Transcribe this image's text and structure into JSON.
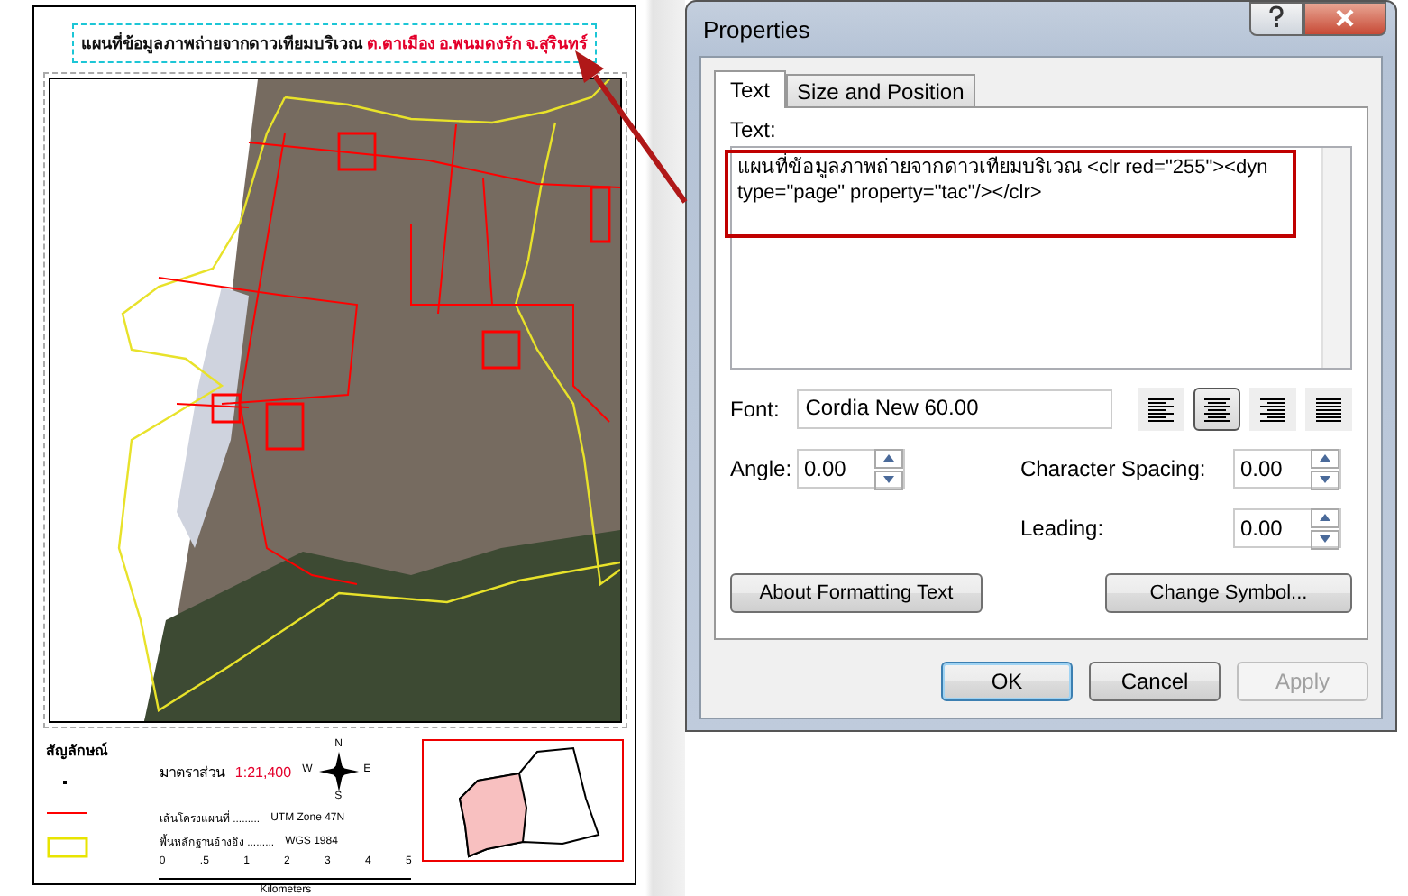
{
  "map_sheet": {
    "title": {
      "text": "แผนที่ข้อมูลภาพถ่ายจากดาวเทียมบริเวณ",
      "highlight": "ต.ตาเมือง อ.พนมดงรัก จ.สุรินทร์"
    },
    "legend": {
      "heading": "สัญลักษณ์"
    },
    "scale": {
      "label": "มาตราส่วน",
      "ratio": "1:21,400",
      "ticks": [
        "0",
        ".5",
        "1",
        "2",
        "3",
        "4",
        "5"
      ],
      "unit": "Kilometers"
    },
    "projection": [
      {
        "label": "เส้นโครงแผนที่ .........",
        "value": "UTM Zone 47N"
      },
      {
        "label": "พื้นหลักฐานอ้างอิง .........",
        "value": "WGS 1984"
      }
    ],
    "north_arrow": {
      "n": "N",
      "w": "W",
      "e": "E",
      "s": "S"
    }
  },
  "dialog": {
    "title": "Properties",
    "tabs": [
      {
        "label": "Text",
        "selected": true
      },
      {
        "label": "Size and Position",
        "selected": false
      }
    ],
    "text_label": "Text:",
    "text_value": "แผนที่ข้อมูลภาพถ่ายจากดาวเทียมบริเวณ <clr red=\"255\"><dyn type=\"page\" property=\"tac\"/></clr>",
    "font": {
      "label": "Font:",
      "value": "Cordia New 60.00"
    },
    "alignments": [
      {
        "kind": "left",
        "selected": false
      },
      {
        "kind": "center",
        "selected": true
      },
      {
        "kind": "right",
        "selected": false
      },
      {
        "kind": "justify",
        "selected": false
      }
    ],
    "spinners": [
      {
        "label": "Angle:",
        "value": "0.00"
      },
      {
        "label": "Character Spacing:",
        "value": "0.00"
      },
      {
        "label": "Leading:",
        "value": "0.00"
      }
    ],
    "buttons": [
      "About Formatting Text",
      "Change Symbol..."
    ],
    "footer_buttons": [
      {
        "label": "OK",
        "default": true,
        "disabled": false
      },
      {
        "label": "Cancel",
        "default": false,
        "disabled": false
      },
      {
        "label": "Apply",
        "default": false,
        "disabled": true
      }
    ]
  }
}
